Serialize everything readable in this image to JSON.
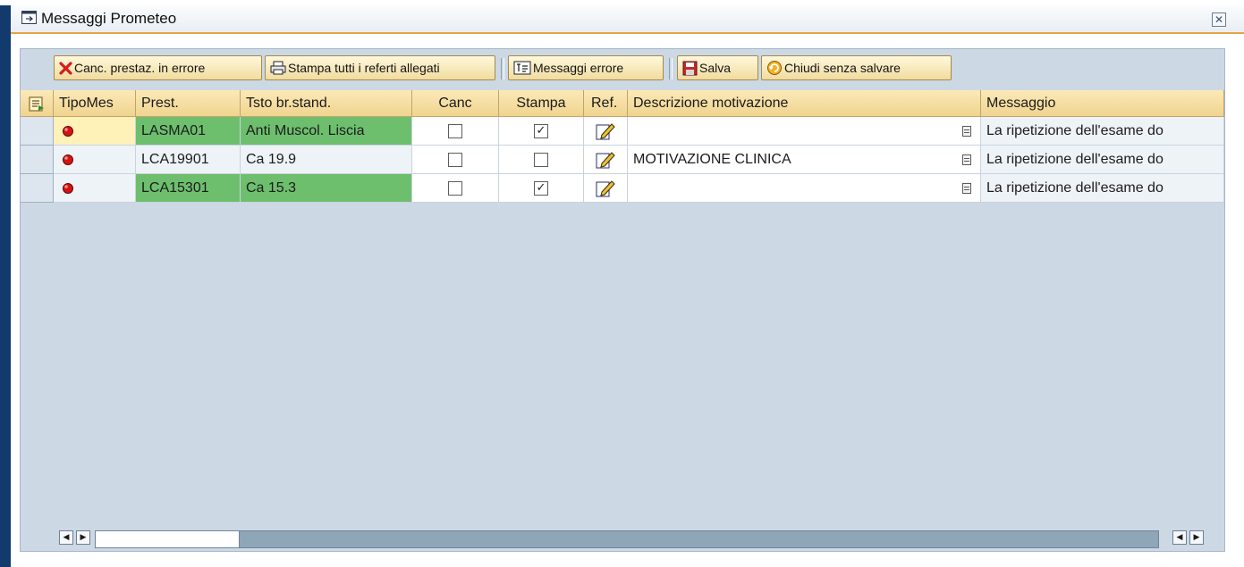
{
  "window": {
    "title": "Messaggi Prometeo",
    "close_glyph": "✕"
  },
  "toolbar": {
    "buttons": [
      {
        "label": "Canc. prestaz. in errore",
        "icon": "red-x-icon"
      },
      {
        "label": "Stampa tutti i referti allegati",
        "icon": "printer-icon"
      },
      {
        "label": "Messaggi errore",
        "icon": "error-messages-icon"
      },
      {
        "label": "Salva",
        "icon": "save-icon"
      },
      {
        "label": "Chiudi senza salvare",
        "icon": "close-without-save-icon"
      }
    ]
  },
  "table": {
    "columns": [
      "TipoMes",
      "Prest.",
      "Tsto br.stand.",
      "Canc",
      "Stampa",
      "Ref.",
      "Descrizione motivazione",
      "Messaggio"
    ],
    "rows": [
      {
        "tipo": "red-status-icon",
        "prest": "LASMA01",
        "tsto": "Anti Muscol. Liscia",
        "canc": false,
        "stampa": true,
        "ref": "edit-pencil-icon",
        "descrizione": "",
        "messaggio": "La ripetizione dell'esame do",
        "highlight": "green"
      },
      {
        "tipo": "red-status-icon",
        "prest": "LCA19901",
        "tsto": "Ca 19.9",
        "canc": false,
        "stampa": false,
        "ref": "edit-pencil-icon",
        "descrizione": "MOTIVAZIONE CLINICA",
        "messaggio": "La ripetizione dell'esame do",
        "highlight": "none"
      },
      {
        "tipo": "red-status-icon",
        "prest": "LCA15301",
        "tsto": "Ca 15.3",
        "canc": false,
        "stampa": true,
        "ref": "edit-pencil-icon",
        "descrizione": "",
        "messaggio": "La ripetizione dell'esame do",
        "highlight": "green"
      }
    ]
  },
  "scrollbar": {
    "left_glyph": "◀",
    "right_glyph": "▶"
  },
  "colors": {
    "title_accent": "#e3a548",
    "header_bg": "#f0d48f",
    "row_highlight": "#6dbf6d",
    "panel_bg": "#ccd8e3",
    "frame_dark": "#123a6c"
  }
}
